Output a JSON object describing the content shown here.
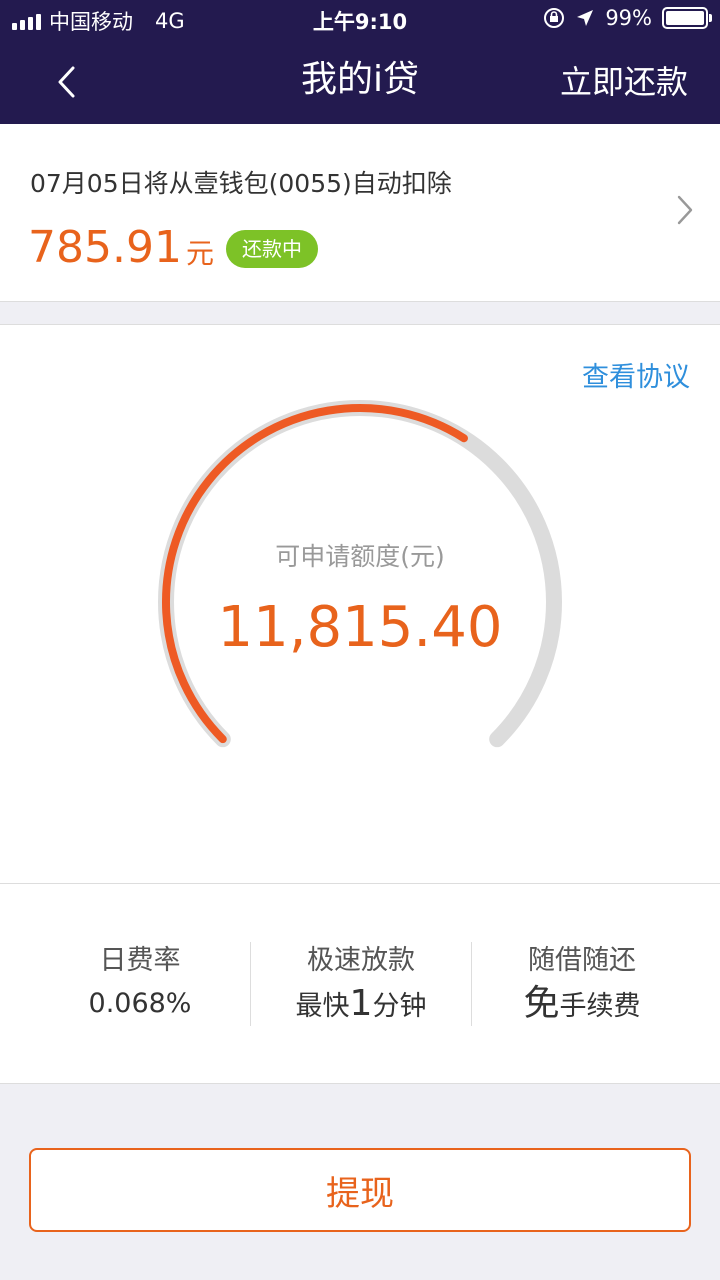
{
  "status_bar": {
    "carrier": "中国移动",
    "network": "4G",
    "time": "上午9:10",
    "battery_text": "99%",
    "battery_level": 0.99
  },
  "nav": {
    "title": "我的i贷",
    "action_label": "立即还款"
  },
  "repayment": {
    "description": "07月05日将从壹钱包(0055)自动扣除",
    "amount": "785.91",
    "unit": "元",
    "status_badge": "还款中"
  },
  "credit": {
    "agreement_link": "查看协议",
    "label": "可申请额度(元)",
    "amount": "11,815.40",
    "gauge_fraction": 0.62
  },
  "features": [
    {
      "title": "日费率",
      "value": "0.068%"
    },
    {
      "title": "极速放款",
      "value_prefix": "最快",
      "value_big": "1",
      "value_suffix": "分钟"
    },
    {
      "title": "随借随还",
      "value_big": "免",
      "value_suffix": "手续费"
    }
  ],
  "withdraw_button": {
    "label": "提现"
  },
  "colors": {
    "header_bg": "#231a4f",
    "accent": "#e8631c",
    "badge_green": "#7dc227",
    "link_blue": "#2f8fdc"
  }
}
